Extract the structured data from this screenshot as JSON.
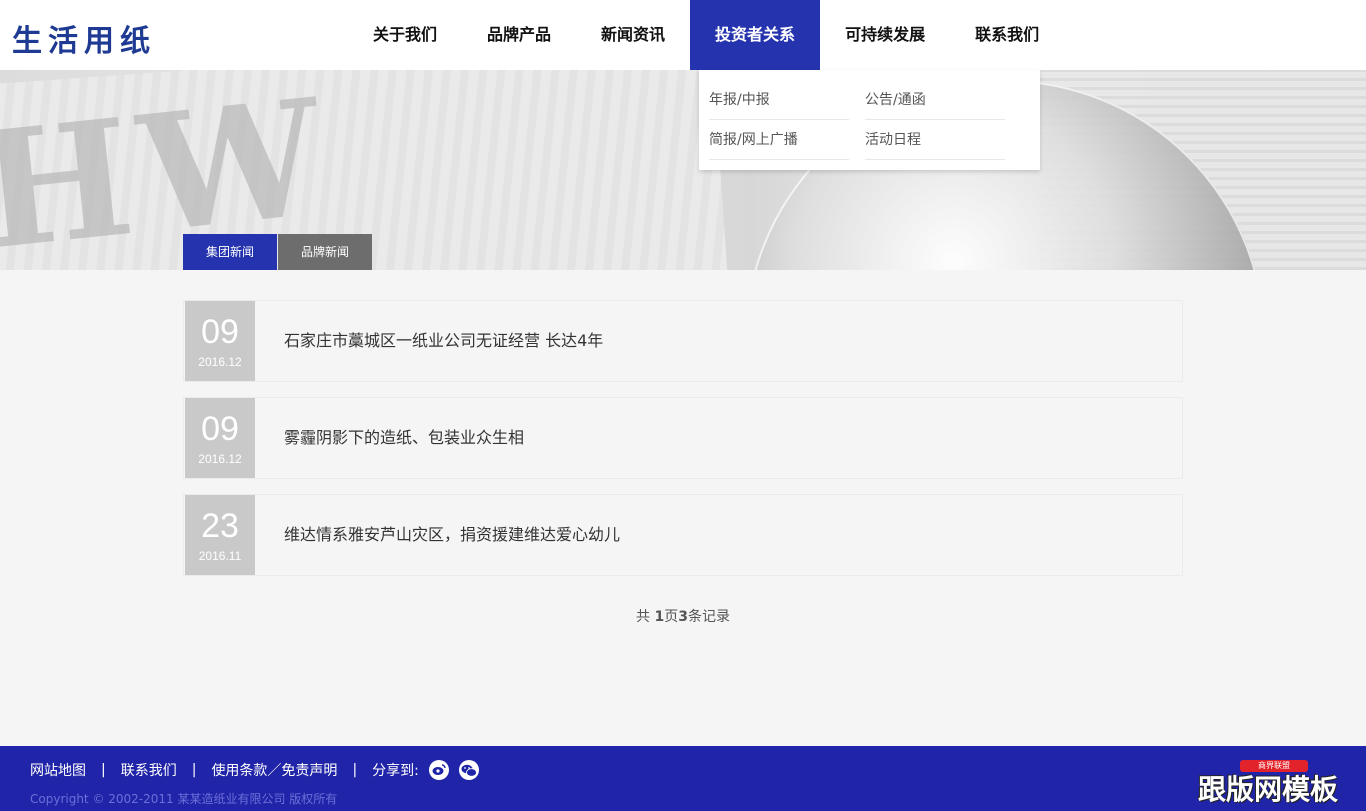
{
  "header": {
    "logo": "生活用纸",
    "nav": [
      {
        "label": "关于我们"
      },
      {
        "label": "品牌产品"
      },
      {
        "label": "新闻资讯"
      },
      {
        "label": "投资者关系",
        "active": true
      },
      {
        "label": "可持续发展"
      },
      {
        "label": "联系我们"
      }
    ],
    "dropdown": [
      "年报/中报",
      "公告/通函",
      "简报/网上广播",
      "活动日程"
    ]
  },
  "tabs": [
    {
      "label": "集团新闻",
      "active": true
    },
    {
      "label": "品牌新闻"
    }
  ],
  "news": [
    {
      "day": "09",
      "ym": "2016.12",
      "title": "石家庄市藁城区一纸业公司无证经营 长达4年"
    },
    {
      "day": "09",
      "ym": "2016.12",
      "title": "雾霾阴影下的造纸、包装业众生相"
    },
    {
      "day": "23",
      "ym": "2016.11",
      "title": "维达情系雅安芦山灾区，捐资援建维达爱心幼儿"
    }
  ],
  "pager": {
    "prefix": "共 ",
    "pages": "1",
    "mid": "页",
    "records": "3",
    "suffix": "条记录"
  },
  "footer": {
    "links": [
      "网站地图",
      "联系我们",
      "使用条款／免责声明"
    ],
    "separator": "|",
    "share_label": "分享到:",
    "share_icons": [
      "weibo-icon",
      "wechat-icon"
    ],
    "copyright": "Copyright © 2002-2011 某某造纸业有限公司 版权所有",
    "watermark": "跟版网模板",
    "watermark_tag": "商界联盟"
  },
  "colors": {
    "accent": "#2534ae",
    "footer_bg": "#2024a8",
    "date_box": "#c9c9c9"
  }
}
